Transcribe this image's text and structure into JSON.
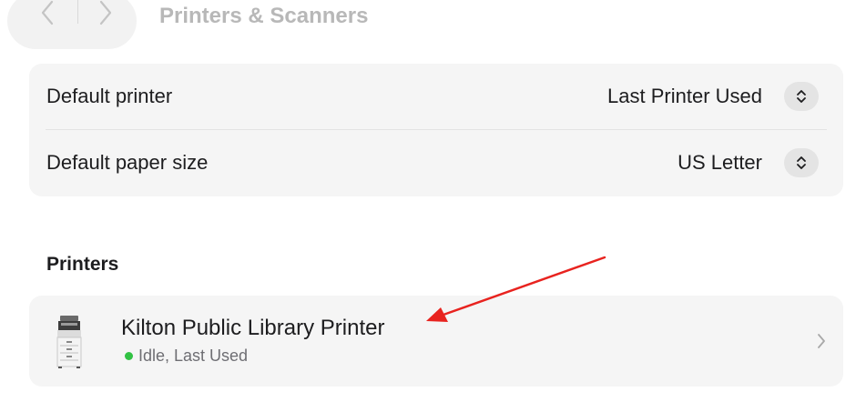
{
  "header": {
    "title": "Printers & Scanners",
    "back_icon": "chevron-left-icon",
    "forward_icon": "chevron-right-icon"
  },
  "settings": {
    "default_printer": {
      "label": "Default printer",
      "value": "Last Printer Used"
    },
    "default_paper_size": {
      "label": "Default paper size",
      "value": "US Letter"
    }
  },
  "printers": {
    "section_title": "Printers",
    "items": [
      {
        "name": "Kilton Public Library Printer",
        "status": "Idle, Last Used",
        "status_color": "#32c244",
        "icon": "printer-icon"
      }
    ]
  },
  "annotation": {
    "arrow_color": "#e8231f"
  }
}
